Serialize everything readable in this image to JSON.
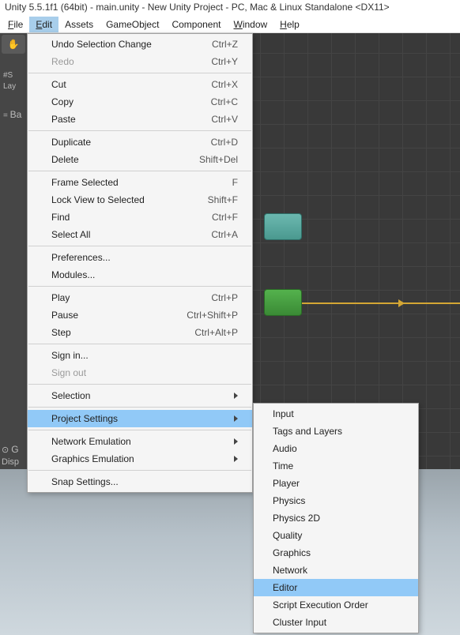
{
  "title": "Unity 5.5.1f1 (64bit) - main.unity - New Unity Project - PC, Mac & Linux Standalone <DX11>",
  "menubar": {
    "file": "File",
    "edit": "Edit",
    "assets": "Assets",
    "gameobject": "GameObject",
    "component": "Component",
    "window": "Window",
    "help": "Help"
  },
  "side": {
    "layers": "Lay",
    "base": "Ba",
    "gizmos": "G",
    "display": "Disp"
  },
  "edit_menu": {
    "undo": "Undo Selection Change",
    "undo_sc": "Ctrl+Z",
    "redo": "Redo",
    "redo_sc": "Ctrl+Y",
    "cut": "Cut",
    "cut_sc": "Ctrl+X",
    "copy": "Copy",
    "copy_sc": "Ctrl+C",
    "paste": "Paste",
    "paste_sc": "Ctrl+V",
    "duplicate": "Duplicate",
    "duplicate_sc": "Ctrl+D",
    "delete": "Delete",
    "delete_sc": "Shift+Del",
    "frame": "Frame Selected",
    "frame_sc": "F",
    "lock": "Lock View to Selected",
    "lock_sc": "Shift+F",
    "find": "Find",
    "find_sc": "Ctrl+F",
    "selectall": "Select All",
    "selectall_sc": "Ctrl+A",
    "prefs": "Preferences...",
    "modules": "Modules...",
    "play": "Play",
    "play_sc": "Ctrl+P",
    "pause": "Pause",
    "pause_sc": "Ctrl+Shift+P",
    "step": "Step",
    "step_sc": "Ctrl+Alt+P",
    "signin": "Sign in...",
    "signout": "Sign out",
    "selection": "Selection",
    "project_settings": "Project Settings",
    "network": "Network Emulation",
    "graphics": "Graphics Emulation",
    "snap": "Snap Settings..."
  },
  "project_submenu": {
    "input": "Input",
    "tags": "Tags and Layers",
    "audio": "Audio",
    "time": "Time",
    "player": "Player",
    "physics": "Physics",
    "physics2d": "Physics 2D",
    "quality": "Quality",
    "graphics": "Graphics",
    "network": "Network",
    "editor": "Editor",
    "script": "Script Execution Order",
    "cluster": "Cluster Input"
  }
}
